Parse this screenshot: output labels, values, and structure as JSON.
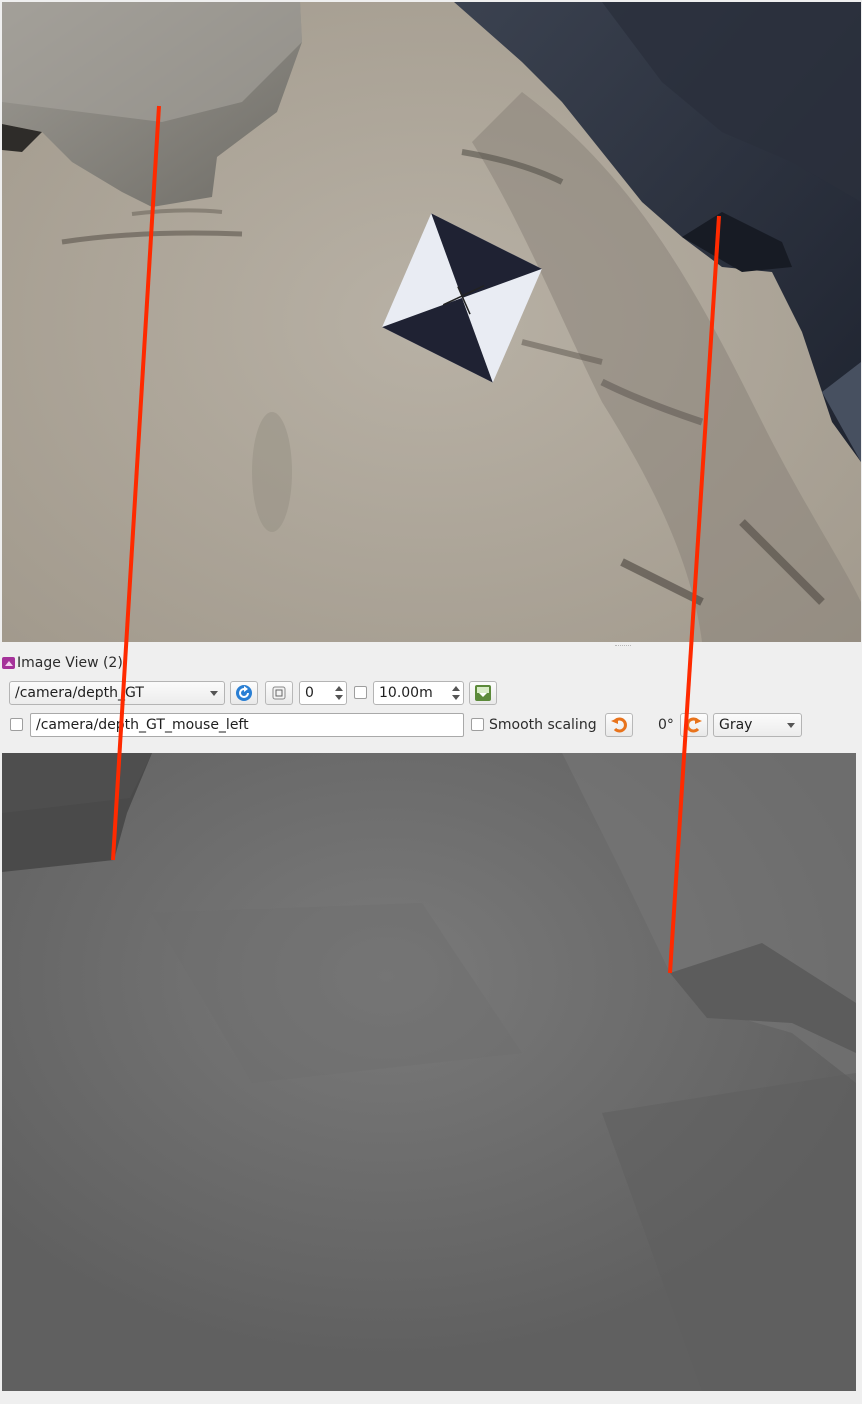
{
  "window": {
    "dock_title": "Image View (2)"
  },
  "toolbar": {
    "topic": "/camera/depth_GT",
    "refresh_icon": "refresh-icon",
    "zoom_icon": "zoom-1-icon",
    "num_gridlines": "0",
    "max_depth": "10.00m",
    "save_icon": "save-image-icon"
  },
  "toolbar2": {
    "publish_topic": "/camera/depth_GT_mouse_left",
    "smooth_scaling_label": "Smooth scaling",
    "rotate_left_icon": "rotate-left-icon",
    "rotation": "0°",
    "rotate_right_icon": "rotate-right-icon",
    "colormap": "Gray"
  },
  "colors": {
    "overlay_line": "#ff2a00",
    "accent_icon": "#2a7fd4",
    "rotate_icon": "#e8731c"
  }
}
